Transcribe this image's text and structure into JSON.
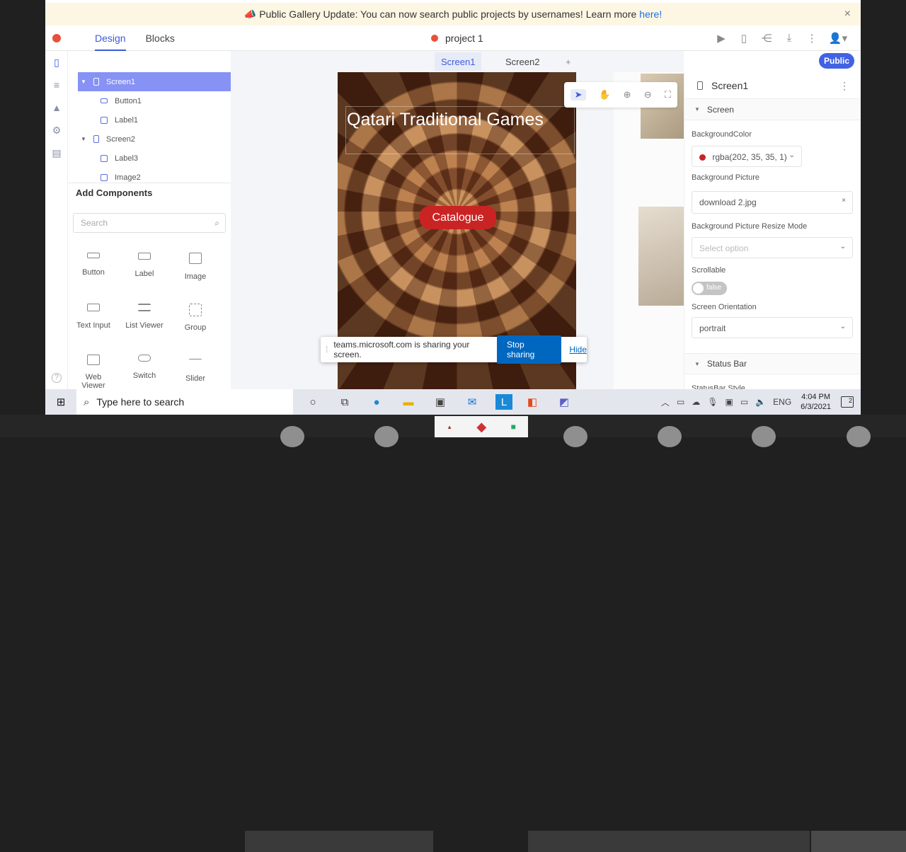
{
  "banner": {
    "text": "Public Gallery Update: You can now search public projects by usernames! Learn more",
    "link": "here!",
    "close_glyph": "×",
    "icon": "megaphone-icon"
  },
  "topbar": {
    "tabs": [
      "Design",
      "Blocks"
    ],
    "project_name": "project 1",
    "icons": [
      "play-icon",
      "phone-icon",
      "share-icon",
      "download-icon",
      "more-vertical-icon",
      "user-icon"
    ]
  },
  "screen_tabs": [
    "Screen1",
    "Screen2"
  ],
  "add_tab_glyph": "+",
  "public_button": "Public",
  "tree": {
    "items": [
      {
        "label": "Screen1",
        "level": 0,
        "selected": true
      },
      {
        "label": "Button1",
        "level": 1
      },
      {
        "label": "Label1",
        "level": 1
      },
      {
        "label": "Screen2",
        "level": 0
      },
      {
        "label": "Label3",
        "level": 1
      },
      {
        "label": "Image2",
        "level": 1
      }
    ]
  },
  "add_components": {
    "title": "Add Components",
    "search_placeholder": "Search",
    "items": [
      {
        "label": "Button",
        "icon": "button-icon"
      },
      {
        "label": "Label",
        "icon": "label-icon"
      },
      {
        "label": "Image",
        "icon": "image-icon"
      },
      {
        "label": "Text Input",
        "icon": "text-input-icon"
      },
      {
        "label": "List Viewer",
        "icon": "list-icon"
      },
      {
        "label": "Group",
        "icon": "group-icon"
      },
      {
        "label": "Web Viewer",
        "icon": "web-viewer-icon"
      },
      {
        "label": "Switch",
        "icon": "switch-icon"
      },
      {
        "label": "Slider",
        "icon": "slider-icon"
      }
    ]
  },
  "app_preview": {
    "title": "Qatari Traditional Games",
    "button": "Catalogue"
  },
  "properties": {
    "component": "Screen1",
    "section_screen": "Screen",
    "background_color_label": "BackgroundColor",
    "background_color_value": "rgba(202, 35, 35, 1)",
    "background_picture_label": "Background Picture",
    "background_picture_value": "download 2.jpg",
    "resize_mode_label": "Background Picture Resize Mode",
    "resize_mode_placeholder": "Select option",
    "scrollable_label": "Scrollable",
    "scrollable_value": "false",
    "orientation_label": "Screen Orientation",
    "orientation_value": "portrait",
    "section_status_bar": "Status Bar",
    "status_bar_style_label": "StatusBar Style"
  },
  "share_bar": {
    "text": "teams.microsoft.com is sharing your screen.",
    "stop": "Stop sharing",
    "hide": "Hide"
  },
  "taskbar": {
    "search_placeholder": "Type here to search",
    "language": "ENG",
    "time": "4:04 PM",
    "date": "6/3/2021",
    "notifications": "2"
  }
}
